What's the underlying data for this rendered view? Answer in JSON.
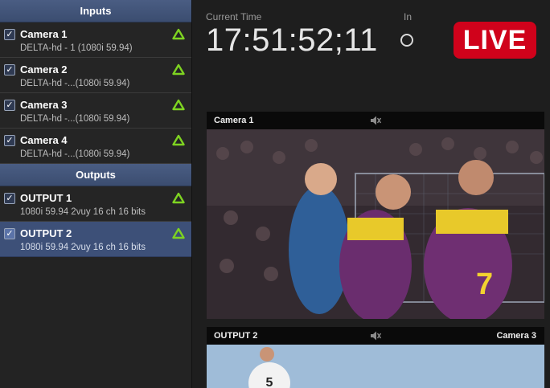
{
  "sidebar": {
    "inputs_header": "Inputs",
    "outputs_header": "Outputs",
    "inputs": [
      {
        "title": "Camera 1",
        "sub": "DELTA-hd - 1 (1080i 59.94)"
      },
      {
        "title": "Camera 2",
        "sub": "DELTA-hd -...(1080i 59.94)"
      },
      {
        "title": "Camera 3",
        "sub": "DELTA-hd -...(1080i 59.94)"
      },
      {
        "title": "Camera 4",
        "sub": "DELTA-hd -...(1080i 59.94)"
      }
    ],
    "outputs": [
      {
        "title": "OUTPUT 1",
        "sub": "1080i 59.94 2vuy 16 ch 16 bits"
      },
      {
        "title": "OUTPUT 2",
        "sub": "1080i 59.94 2vuy 16 ch 16 bits"
      }
    ],
    "check_glyph": "✓"
  },
  "main": {
    "time_label": "Current Time",
    "time_value": "17:51:52;11",
    "in_label": "In",
    "live_label": "LIVE",
    "monitor1": {
      "left_label": "Camera 1",
      "right_label": ""
    },
    "monitor2": {
      "left_label": "OUTPUT 2",
      "right_label": "Camera 3"
    }
  },
  "colors": {
    "accent_live": "#d0021b",
    "selected_row": "#3d5078",
    "status_triangle": "#7ed321"
  },
  "icons": {
    "status": "green-triangle-icon",
    "mute": "speaker-muted-icon"
  }
}
